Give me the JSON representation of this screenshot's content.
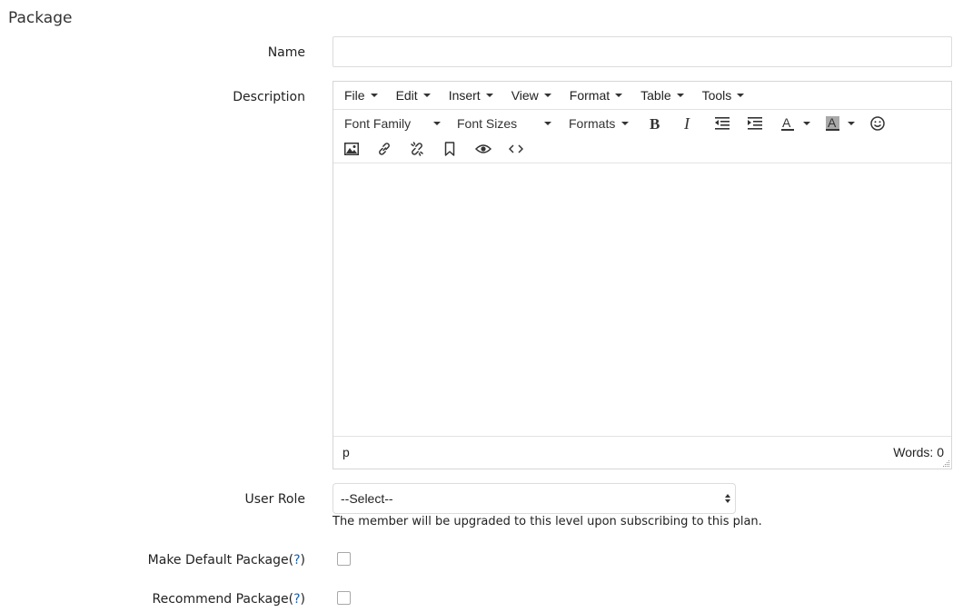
{
  "section": {
    "title": "Package"
  },
  "form": {
    "name_label": "Name",
    "name_value": "",
    "description_label": "Description",
    "user_role_label": "User Role",
    "user_role_selected": "--Select--",
    "user_role_help": "The member will be upgraded to this level upon subscribing to this plan.",
    "default_package_label": "Make Default Package",
    "recommend_package_label": "Recommend Package",
    "help_mark": "?",
    "paren_open": "(",
    "paren_close": ")",
    "default_package_checked": false,
    "recommend_package_checked": false
  },
  "editor": {
    "menus": [
      "File",
      "Edit",
      "Insert",
      "View",
      "Format",
      "Table",
      "Tools"
    ],
    "font_family_label": "Font Family",
    "font_sizes_label": "Font Sizes",
    "formats_label": "Formats",
    "toolbar_icons": [
      "bold-icon",
      "italic-icon",
      "outdent-icon",
      "indent-icon",
      "text-color-icon",
      "background-color-icon",
      "emoticons-icon",
      "image-icon",
      "link-icon",
      "unlink-icon",
      "bookmark-icon",
      "preview-icon",
      "code-icon"
    ],
    "content": "",
    "status_path": "p",
    "word_count": "Words: 0"
  },
  "colors": {
    "help_link": "#1a5fa8",
    "border": "#dcdcdc"
  }
}
